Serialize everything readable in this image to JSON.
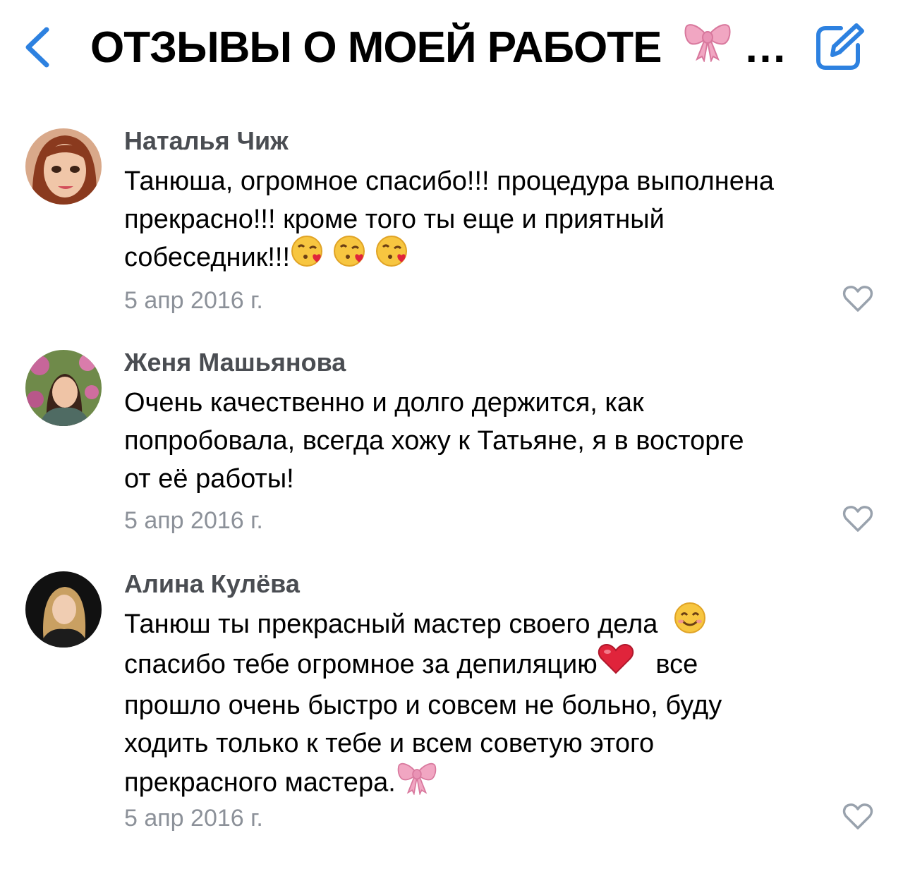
{
  "header": {
    "title": "ОТЗЫВЫ О МОЕЙ РАБОТЕ",
    "title_emoji": "bow-emoji",
    "ellipsis": "…",
    "back_icon": "chevron-left-icon",
    "edit_icon": "edit-icon",
    "accent_color": "#2d81e0"
  },
  "comments": [
    {
      "author": "Наталья Чиж",
      "lines": [
        "Танюша, огромное спасибо!!! процедура выполнена",
        "прекрасно!!! кроме того ты еще и приятный",
        "собеседник!!!"
      ],
      "emojis": [
        "kissing-face-heart-emoji",
        "kissing-face-heart-emoji",
        "kissing-face-heart-emoji"
      ],
      "date": "5 апр 2016 г."
    },
    {
      "author": "Женя Машьянова",
      "lines": [
        "Очень качественно и долго держится, как",
        "попробовала, всегда хожу к Татьяне, я в восторге",
        "от её работы!"
      ],
      "date": "5 апр 2016 г."
    },
    {
      "author": "Алина Кулёва",
      "lines": [
        "Танюш ты прекрасный мастер своего дела",
        "спасибо тебе огромное за депиляцию",
        "все",
        "прошло очень быстро и совсем не больно, буду",
        "ходить только к тебе и всем советую этого",
        "прекрасного мастера."
      ],
      "emojis": [
        "smiling-face-emoji",
        "red-heart-emoji",
        "bow-emoji"
      ],
      "date": "5 апр 2016 г."
    }
  ],
  "colors": {
    "author": "#4a4d52",
    "date": "#8c9199",
    "like_icon": "#99a2ad"
  }
}
